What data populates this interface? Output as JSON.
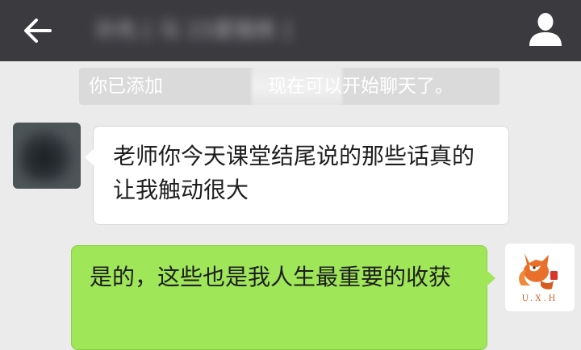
{
  "header": {
    "back_icon": "arrow-left-icon",
    "title": "孙先 [ 马 15爱锻炼 ]",
    "profile_icon": "user-icon"
  },
  "system_notice": {
    "text_before": "你已添加",
    "text_after": "现在可以开始聊天了。"
  },
  "messages": [
    {
      "sender": "contact",
      "text": "老师你今天课堂结尾说的那些话真的让我触动很大",
      "bubble_color": "#ffffff"
    },
    {
      "sender": "self",
      "text": "是的，这些也是我人生最重要的收获",
      "bubble_color": "#9fe658"
    }
  ],
  "self_avatar": {
    "logo_text": "U.X.H",
    "accent": "#e8702a"
  },
  "colors": {
    "topbar": "#3a3a3f",
    "chat_background": "#ebebeb",
    "notice_background": "#dadada"
  }
}
